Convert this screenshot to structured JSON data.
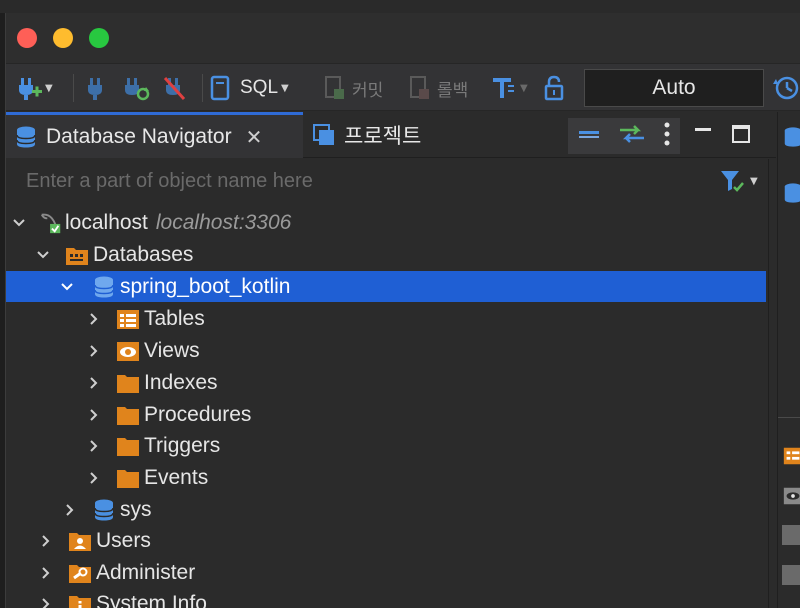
{
  "toolbar": {
    "sql_label": "SQL",
    "commit_label": "커밋",
    "rollback_label": "롤백",
    "transaction_mode": "Auto"
  },
  "tabs": [
    {
      "label": "Database Navigator",
      "active": true,
      "icon": "database-stack-icon"
    },
    {
      "label": "프로젝트",
      "active": false,
      "icon": "project-window-icon"
    }
  ],
  "navigator": {
    "filter_placeholder": "Enter a part of object name here",
    "tree": {
      "connection": {
        "name": "localhost",
        "address": "localhost:3306"
      },
      "databases_label": "Databases",
      "schema": "spring_boot_kotlin",
      "schema_children": [
        "Tables",
        "Views",
        "Indexes",
        "Procedures",
        "Triggers",
        "Events"
      ],
      "other_schema": "sys",
      "users_label": "Users",
      "administer_label": "Administer",
      "system_info_label": "System Info"
    }
  },
  "colors": {
    "selection": "#1f5fd4",
    "folder": "#e0841c",
    "db_blue": "#4a90e2",
    "active_tab_border": "#2f6bd6"
  }
}
